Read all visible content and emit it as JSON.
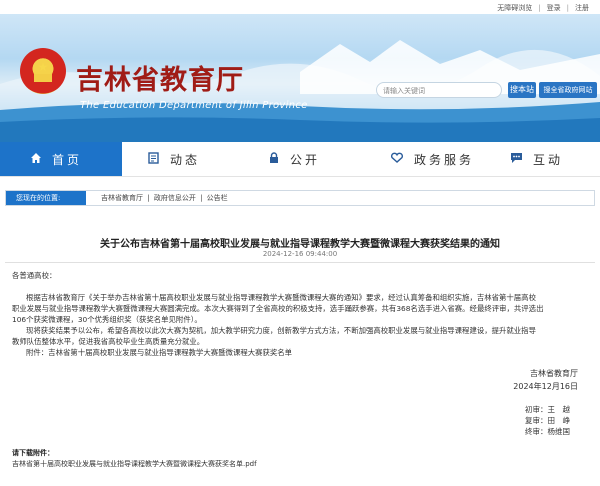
{
  "topbar": {
    "links": [
      "无障碍浏览",
      "登录",
      "注册"
    ]
  },
  "header": {
    "title": "吉林省教育厅",
    "subtitle_en": "The Education Department of Jilin Province",
    "search_placeholder": "请输入关键词",
    "search_button": "搜本站",
    "search_all_button": "搜全省政府网站"
  },
  "nav": [
    {
      "label": "首页",
      "icon": "home-icon"
    },
    {
      "label": "动态",
      "icon": "news-icon"
    },
    {
      "label": "公开",
      "icon": "lock-icon"
    },
    {
      "label": "政务服务",
      "icon": "heart-hand-icon"
    },
    {
      "label": "互动",
      "icon": "chat-icon"
    }
  ],
  "location": {
    "label": "您现在的位置:",
    "crumbs": [
      "吉林省教育厅",
      "政府信息公开",
      "公告栏"
    ],
    "separator": "|"
  },
  "article": {
    "title": "关于公布吉林省第十届高校职业发展与就业指导课程教学大赛暨微课程大赛获奖结果的通知",
    "date": "2024-12-16 09:44:00",
    "greeting": "各普通高校：",
    "p1_l1": "根据吉林省教育厅《关于举办吉林省第十届高校职业发展与就业指导课程教学大赛暨微课程大赛的通知》要求，经过认真筹备和组织实施，吉林省第十届高校",
    "p1_l2": "职业发展与就业指导课程教学大赛暨微课程大赛圆满完成。本次大赛得到了全省高校的积极支持，选手踊跃参赛，共有368名选手进入省赛。经最终评审，共评选出",
    "p1_l3": "106个获奖微课程，30个优秀组织奖（获奖名单见附件）。",
    "p2_l1": "现将获奖结果予以公布，希望各高校以此次大赛为契机，加大教学研究力度，创新教学方式方法，不断加强高校职业发展与就业指导课程建设，提升就业指导",
    "p2_l2": "教师队伍整体水平，促进我省高校毕业生高质量充分就业。",
    "attachment": "附件：吉林省第十届高校职业发展与就业指导课程教学大赛暨微课程大赛获奖名单",
    "sign_org": "吉林省教育厅",
    "sign_date": "2024年12月16日",
    "approvers": [
      {
        "role": "初审：",
        "name": "王　越"
      },
      {
        "role": "复审：",
        "name": "田　峥"
      },
      {
        "role": "终审：",
        "name": "杨维国"
      }
    ],
    "download_label": "请下载附件：",
    "download_file": "吉林省第十届高校职业发展与就业指导课程教学大赛暨微课程大赛获奖名单.pdf"
  },
  "colors": {
    "nav_active": "#1d73c9",
    "title_red": "#a01c16",
    "button_blue": "#2a75c4"
  }
}
